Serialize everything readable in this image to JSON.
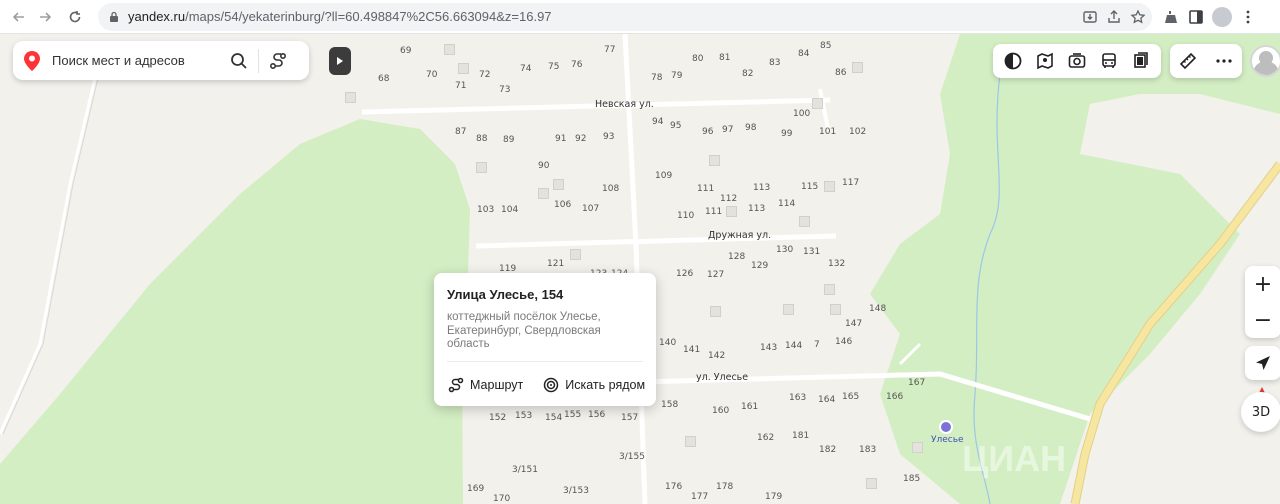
{
  "browser": {
    "url_domain": "yandex.ru",
    "url_path": "/maps/54/yekaterinburg/?ll=60.498847%2C56.663094&z=16.97",
    "back_icon": "arrow-left-icon",
    "forward_icon": "arrow-right-icon",
    "reload_icon": "reload-icon"
  },
  "search": {
    "placeholder": "Поиск мест и адресов"
  },
  "info_card": {
    "title": "Улица Улесье, 154",
    "subtitle": "коттеджный посёлок Улесье, Екатеринбург, Свердловская область",
    "route_label": "Маршрут",
    "nearby_label": "Искать рядом"
  },
  "controls": {
    "zoom_in": "+",
    "zoom_out": "−",
    "btn_3d": "3D"
  },
  "map": {
    "streets": [
      "Невская ул.",
      "Дружная ул.",
      "ул. Улесье"
    ],
    "poi": "Улесье",
    "watermark": "ЦИАН",
    "house_numbers": [
      "69",
      "68",
      "70",
      "72",
      "71",
      "74",
      "75",
      "76",
      "77",
      "73",
      "80",
      "81",
      "84",
      "85",
      "78",
      "79",
      "82",
      "83",
      "86",
      "100",
      "87",
      "88",
      "89",
      "91",
      "92",
      "93",
      "94",
      "95",
      "96",
      "97",
      "98",
      "99",
      "101",
      "102",
      "90",
      "109",
      "108",
      "111",
      "112",
      "113",
      "115",
      "117",
      "103",
      "104",
      "106",
      "107",
      "110",
      "111",
      "113",
      "114",
      "119",
      "121",
      "123",
      "124",
      "126",
      "127",
      "128",
      "129",
      "130",
      "131",
      "132",
      "148",
      "147",
      "140",
      "141",
      "142",
      "143",
      "144",
      "7",
      "146",
      "158",
      "160",
      "161",
      "163",
      "164",
      "165",
      "166",
      "167",
      "152",
      "153",
      "154",
      "155",
      "156",
      "157",
      "162",
      "181",
      "182",
      "183",
      "3/151",
      "3/155",
      "169",
      "170",
      "3/153",
      "176",
      "177",
      "178",
      "179",
      "185"
    ]
  },
  "colors": {
    "land": "#f2f1ec",
    "forest": "#d4eec4",
    "road": "#ffffff",
    "main_road": "#f7e6a0",
    "accent_red": "#ff3333"
  }
}
